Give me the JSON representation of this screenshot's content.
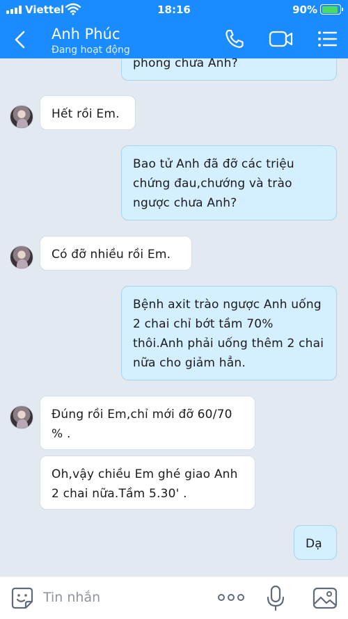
{
  "status_bar": {
    "carrier": "Viettel",
    "time": "18:16",
    "battery": "90%",
    "battery_level": 0.9
  },
  "header": {
    "contact_name": "Anh Phúc",
    "contact_status": "Đang hoạt động",
    "icons": [
      "back-icon",
      "phone-icon",
      "video-call-icon",
      "list-menu-icon"
    ]
  },
  "messages": [
    {
      "side": "out",
      "text": "phong chưa Anh?"
    },
    {
      "side": "in",
      "text": "Hết rồi Em."
    },
    {
      "side": "out",
      "text": "Bao tử Anh đã đỡ các triệu chứng đau,chướng và trào ngược chưa Anh?"
    },
    {
      "side": "in",
      "text": "Có đỡ nhiều rồi Em."
    },
    {
      "side": "out",
      "text": "Bệnh axit trào ngược Anh uống 2 chai chỉ bớt tầm 70% thôi.Anh phải uống thêm 2 chai nữa cho giảm hẳn."
    },
    {
      "side": "in",
      "text": "Đúng rồi Em,chỉ mới đỡ 60/70 % ."
    },
    {
      "side": "in",
      "text": "Oh,vậy chiều Em ghé giao Anh 2 chai nữa.Tầm 5.30' ."
    },
    {
      "side": "out",
      "text": "Dạ"
    }
  ],
  "composer": {
    "placeholder": "Tin nhắn",
    "icons": [
      "sticker-icon",
      "more-dots-icon",
      "microphone-icon",
      "image-icon"
    ]
  },
  "colors": {
    "header_bg": "#1a8cff",
    "chat_bg": "#e2e9f1",
    "outgoing_bubble": "#d4efff",
    "incoming_bubble": "#ffffff"
  }
}
